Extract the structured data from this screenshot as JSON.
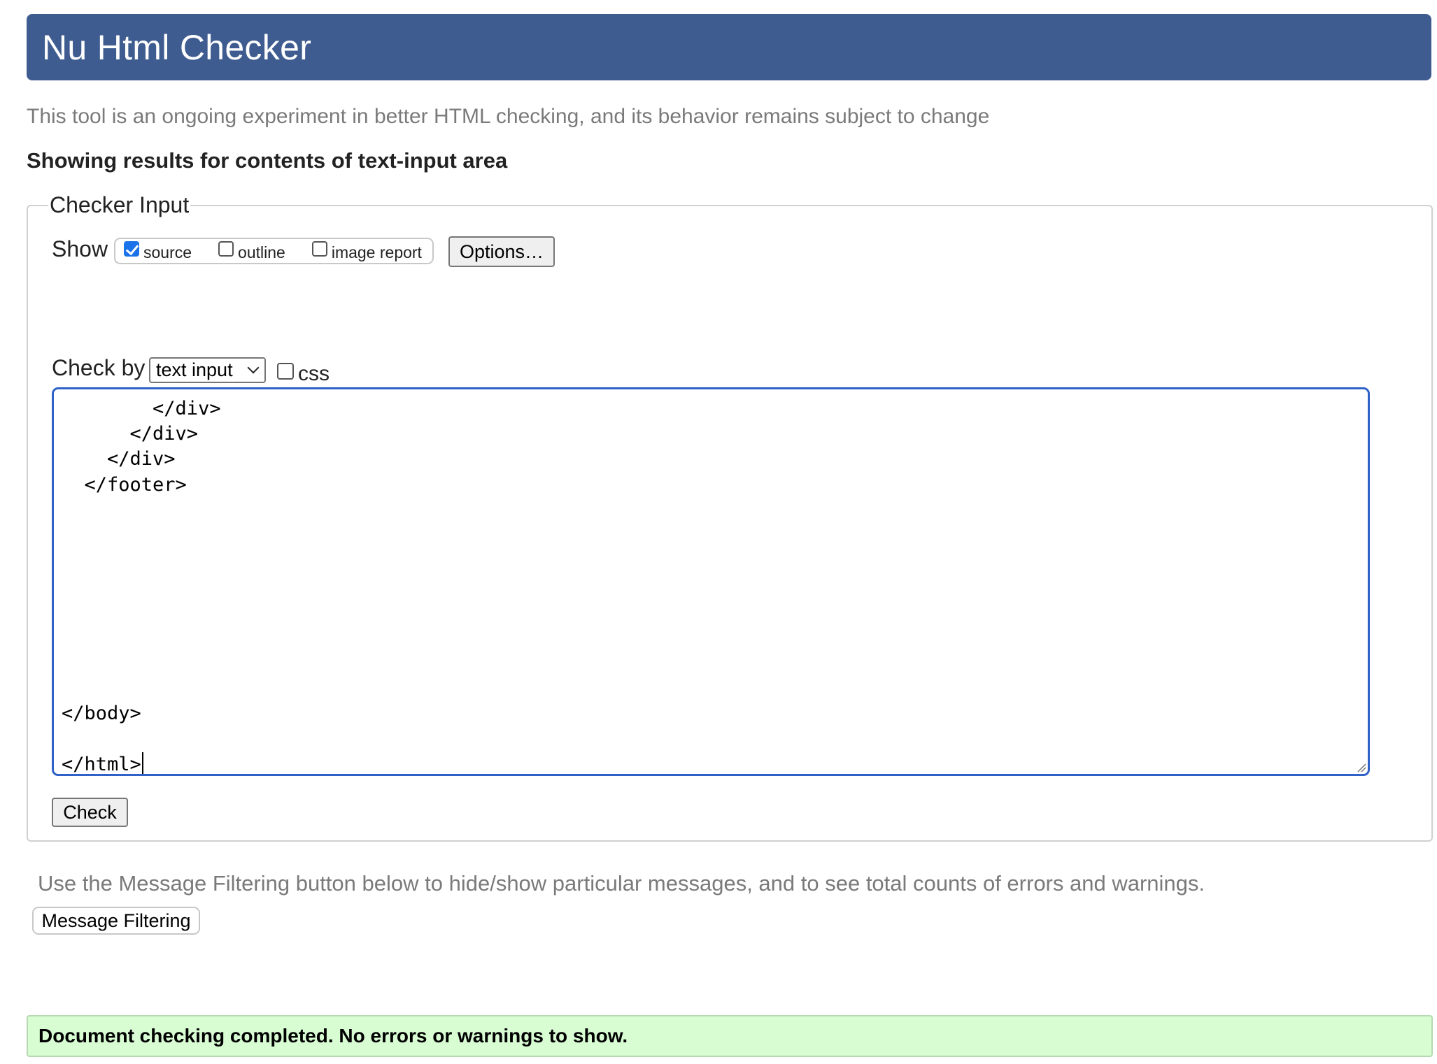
{
  "header": {
    "title": "Nu Html Checker"
  },
  "subtitle": "This tool is an ongoing experiment in better HTML checking, and its behavior remains subject to change",
  "results_heading": "Showing results for contents of text-input area",
  "checker_input": {
    "legend": "Checker Input",
    "show_label": "Show",
    "show_options": [
      {
        "label": "source",
        "checked": true
      },
      {
        "label": "outline",
        "checked": false
      },
      {
        "label": "image report",
        "checked": false
      }
    ],
    "options_button": "Options…",
    "check_by_label": "Check by",
    "check_by_select": "text input",
    "css_option": {
      "label": "css",
      "checked": false
    },
    "code_lines": [
      "        </div>",
      "      </div>",
      "    </div>",
      "  </footer>",
      "</body>",
      "</html>"
    ],
    "check_button": "Check"
  },
  "filter_note": "Use the Message Filtering button below to hide/show particular messages, and to see total counts of errors and warnings.",
  "filter_button": "Message Filtering",
  "status_message": "Document checking completed. No errors or warnings to show.",
  "colors": {
    "header_bg": "#3e5c90",
    "textarea_focus": "#2f62c7",
    "success_bg": "#d8fdd3",
    "checkbox_checked": "#1a73e8"
  }
}
